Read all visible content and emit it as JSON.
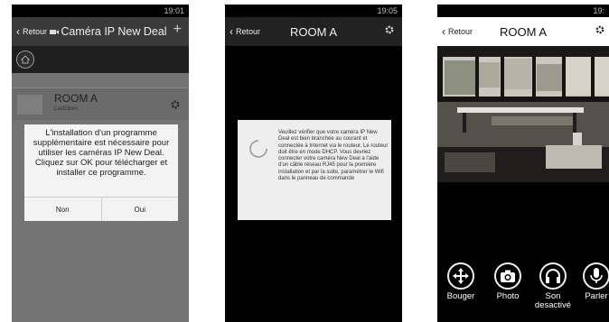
{
  "phone1": {
    "status_time": "19:01",
    "back_label": "Retour",
    "title": "Caméra IP New Deal",
    "add_symbol": "+",
    "camera": {
      "name": "ROOM A",
      "sub": "LastOpen"
    },
    "dialog": {
      "message": "L'installation d'un programme supplémentaire est nécessaire pour utiliser les caméras IP New Deal.  Cliquez sur OK pour télécharger et installer ce programme.",
      "cancel_label": "Non",
      "ok_label": "Oui"
    }
  },
  "phone2": {
    "status_time": "19:05",
    "back_label": "Retour",
    "title": "ROOM A",
    "loading_message": "Veuillez vérifier que votre caméra IP New Deal est bien branchée au courant et connectée à Internet via le routeur. Le routeur doit être en mode DHCP. Vous devriez connecter votre caméra New Deal a l'aide d'un câble réseau RJ45 pour la première installation et par la suite, paramétrer le Wifi dans le panneau de commande"
  },
  "phone3": {
    "status_time": "19:",
    "back_label": "Retour",
    "title": "ROOM A",
    "controls": [
      {
        "icon": "move-arrows-icon",
        "label": "Bouger"
      },
      {
        "icon": "camera-icon",
        "label": "Photo"
      },
      {
        "icon": "headphones-icon",
        "label": "Son desactivé"
      },
      {
        "icon": "microphone-icon",
        "label": "Parler"
      }
    ]
  }
}
